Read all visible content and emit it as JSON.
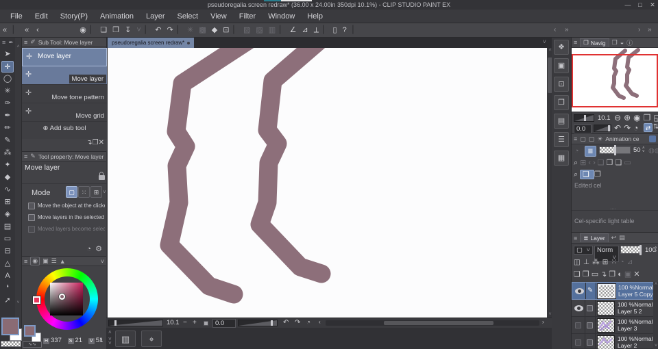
{
  "window": {
    "title": "pseudoregalia screen redraw* (36.00 x 24.00in 350dpi 10.1%)  - CLIP STUDIO PAINT EX",
    "minimize": "—",
    "maximize": "□",
    "close": "✕"
  },
  "menu": {
    "items": [
      {
        "name": "menu-file",
        "label": "File"
      },
      {
        "name": "menu-edit",
        "label": "Edit"
      },
      {
        "name": "menu-story",
        "label": "Story(P)"
      },
      {
        "name": "menu-animation",
        "label": "Animation"
      },
      {
        "name": "menu-layer",
        "label": "Layer"
      },
      {
        "name": "menu-select",
        "label": "Select"
      },
      {
        "name": "menu-view",
        "label": "View"
      },
      {
        "name": "menu-filter",
        "label": "Filter"
      },
      {
        "name": "menu-window",
        "label": "Window"
      },
      {
        "name": "menu-help",
        "label": "Help"
      }
    ]
  },
  "toolbar": {
    "icons": [
      {
        "name": "csp-logo-icon",
        "glyph": "◉"
      },
      {
        "name": "toolbar-sep-1",
        "glyph": "▏",
        "cls": "sep",
        "inter": false
      },
      {
        "name": "new-file-icon",
        "glyph": "❏"
      },
      {
        "name": "open-file-icon",
        "glyph": "❐"
      },
      {
        "name": "save-file-icon",
        "glyph": "↧"
      },
      {
        "name": "save-dropdown-caret",
        "glyph": "˅",
        "cls": "dim"
      },
      {
        "name": "toolbar-sep-2",
        "glyph": "▏",
        "cls": "sep",
        "inter": false
      },
      {
        "name": "undo-icon",
        "glyph": "↶"
      },
      {
        "name": "redo-icon",
        "glyph": "↷"
      },
      {
        "name": "toolbar-sep-3",
        "glyph": "▏",
        "cls": "sep",
        "inter": false
      },
      {
        "name": "clear-icon",
        "glyph": "✳",
        "cls": "dim"
      },
      {
        "name": "fill-area-icon",
        "glyph": "▩",
        "cls": "dim"
      },
      {
        "name": "bucket-fill-icon",
        "glyph": "◆"
      },
      {
        "name": "crop-canvas-icon",
        "glyph": "⊡"
      },
      {
        "name": "toolbar-sep-4",
        "glyph": "▏",
        "cls": "sep",
        "inter": false
      },
      {
        "name": "deselect-icon",
        "glyph": "▧",
        "cls": "dim"
      },
      {
        "name": "invert-selection-icon",
        "glyph": "▨",
        "cls": "dim"
      },
      {
        "name": "selection-border-icon",
        "glyph": "▥",
        "cls": "dim"
      },
      {
        "name": "toolbar-sep-5",
        "glyph": "▏",
        "cls": "sep",
        "inter": false
      },
      {
        "name": "snap-ruler-icon",
        "glyph": "∠"
      },
      {
        "name": "snap-special-ruler-icon",
        "glyph": "⊿"
      },
      {
        "name": "snap-grid-icon",
        "glyph": "⟂"
      },
      {
        "name": "toolbar-sep-6",
        "glyph": "▏",
        "cls": "sep",
        "inter": false
      },
      {
        "name": "tablet-mode-icon",
        "glyph": "▯"
      },
      {
        "name": "help-icon",
        "glyph": "?"
      }
    ]
  },
  "tools": [
    {
      "name": "operation-tool",
      "glyph": "➤"
    },
    {
      "name": "move-layer-tool",
      "glyph": "✛",
      "cls": "sel"
    },
    {
      "name": "selection-tool",
      "glyph": "◯"
    },
    {
      "name": "auto-select-tool",
      "glyph": "✳"
    },
    {
      "name": "eyedropper-tool",
      "glyph": "✑"
    },
    {
      "name": "pen-tool",
      "glyph": "✒"
    },
    {
      "name": "pencil-tool",
      "glyph": "✏"
    },
    {
      "name": "brush-tool",
      "glyph": "✎"
    },
    {
      "name": "airbrush-tool",
      "glyph": "⁂"
    },
    {
      "name": "decoration-tool",
      "glyph": "✦"
    },
    {
      "name": "eraser-tool",
      "glyph": "◆"
    },
    {
      "name": "blend-tool",
      "glyph": "∿"
    },
    {
      "name": "liquify-tool",
      "glyph": "⊞"
    },
    {
      "name": "fill-tool",
      "glyph": "◈"
    },
    {
      "name": "gradient-tool",
      "glyph": "▤"
    },
    {
      "name": "figure-tool",
      "glyph": "▭"
    },
    {
      "name": "frame-border-tool",
      "glyph": "⊟"
    },
    {
      "name": "ruler-tool",
      "glyph": "△"
    },
    {
      "name": "text-tool",
      "glyph": "A"
    },
    {
      "name": "balloon-tool",
      "glyph": "❛"
    },
    {
      "name": "correct-line-tool",
      "glyph": "➚"
    }
  ],
  "subtool": {
    "header": "Sub Tool: Move layer",
    "items": [
      "Move layer",
      "Move layer",
      "Move tone pattern",
      "Move grid"
    ],
    "add_label": "Add sub tool",
    "footer_icons": [
      {
        "name": "import-subtool-icon",
        "glyph": "↴"
      },
      {
        "name": "duplicate-subtool-icon",
        "glyph": "❐"
      },
      {
        "name": "delete-subtool-icon",
        "glyph": "✕"
      }
    ]
  },
  "toolprop": {
    "header": "Tool property: Move layer",
    "tool_name": "Move layer",
    "mode_label": "Mode",
    "options": [
      "Move the object at the clicke",
      "Move layers in the selected a",
      "Moved layers become selecte"
    ]
  },
  "colorpanel": {
    "h_label": "H",
    "s_label": "S",
    "v_label": "V",
    "h": "337",
    "s": "21",
    "v": "51",
    "main_color": "#8a6b74",
    "sub_color": "#ffffff"
  },
  "canvas": {
    "tab": "pseudoregalia screen redraw*",
    "stroke_color": "#8d6f7a",
    "strokes": [
      "M 213 -16 L 109 52 L 100 122 L 114 144 L 101 172 L 104 226 L 90 288 L 148 348 L 184 360",
      "M 315 -16 L 241 48 L 233 120 L 248 140 L 235 168 L 233 226 L 222 258 L 281 320 L 312 330"
    ],
    "zoom": "10.1",
    "rotation": "0.0"
  },
  "dock_icons": [
    {
      "name": "dock-quick-access-icon",
      "glyph": "❖"
    },
    {
      "name": "dock-material-icon",
      "glyph": "▣"
    },
    {
      "name": "dock-material-2-icon",
      "glyph": "⊡"
    },
    {
      "name": "dock-sub-view-icon",
      "glyph": "❐"
    },
    {
      "name": "dock-item-bank-icon",
      "glyph": "▤"
    },
    {
      "name": "dock-history-icon",
      "glyph": "☰"
    },
    {
      "name": "dock-3d-material-icon",
      "glyph": "▦"
    }
  ],
  "navigator": {
    "tab_label": "Navig",
    "zoom": "10.1",
    "rotation": "0.0",
    "frame_color": "#e03232",
    "strokes": [
      "M78 4 L64 16 L62 30 L65 34 L62 41 L62 52 L60 58 L69 70 L76 73",
      "M97 3 L83 14 L81 28 L84 32 L81 39 L81 50 L79 55 L88 67 L95 70"
    ],
    "row1_icons": [
      {
        "name": "zoom-out-icon",
        "glyph": "⊖"
      },
      {
        "name": "zoom-in-icon",
        "glyph": "⊕"
      },
      {
        "name": "zoom-100-icon",
        "glyph": "◉"
      },
      {
        "name": "fit-to-window-icon",
        "glyph": "❐"
      },
      {
        "name": "fit-to-screen-icon",
        "glyph": "◱"
      }
    ],
    "row2_icons": [
      {
        "name": "rotate-left-icon",
        "glyph": "↶"
      },
      {
        "name": "rotate-right-icon",
        "glyph": "↷"
      },
      {
        "name": "reset-rotation-icon",
        "glyph": "◔"
      }
    ]
  },
  "animation": {
    "tab_label": "Animation ce",
    "opacity": "50",
    "edited_cel": "Edited cel",
    "light_table": "Cel-specific light table",
    "row2_icons": [
      {
        "name": "register-image-icon",
        "glyph": "⌕"
      },
      {
        "name": "lock-cel-icon",
        "glyph": "⊞",
        "cls": "dim"
      },
      {
        "name": "prev-cel-icon",
        "glyph": "‹",
        "cls": "dim"
      },
      {
        "name": "next-cel-icon",
        "glyph": "›",
        "cls": "dim"
      },
      {
        "name": "new-cel-icon",
        "glyph": "❏",
        "cls": "dim"
      },
      {
        "name": "open-light-table-icon",
        "glyph": "❐"
      },
      {
        "name": "copy-cel-icon",
        "glyph": "❏"
      },
      {
        "name": "paste-cel-icon",
        "glyph": "▭",
        "cls": "dim"
      }
    ],
    "row3_icons": [
      {
        "name": "search-cel-icon",
        "glyph": "⌕"
      },
      {
        "name": "edit-cel-icon",
        "glyph": "❏",
        "cls": "blue"
      },
      {
        "name": "cel-copy-icon",
        "glyph": "❐"
      }
    ]
  },
  "layers": {
    "tab": "Layer",
    "blend": "Norm",
    "opacity": "100",
    "row2_icons": [
      {
        "name": "clip-to-layer-icon",
        "glyph": "◫"
      },
      {
        "name": "reference-layer-icon",
        "glyph": "⊥"
      },
      {
        "name": "draft-layer-icon",
        "glyph": "⁂"
      },
      {
        "name": "lock-layer-icon",
        "glyph": "⊞"
      },
      {
        "name": "lock-alpha-icon",
        "glyph": "⁙"
      },
      {
        "name": "enable-mask-icon",
        "glyph": "◔",
        "cls": "dim"
      },
      {
        "name": "ruler-range-icon",
        "glyph": "⊿",
        "cls": "dim"
      }
    ],
    "row3_icons": [
      {
        "name": "new-layer-icon",
        "glyph": "❏"
      },
      {
        "name": "new-vector-layer-icon",
        "glyph": "❒"
      },
      {
        "name": "new-folder-icon",
        "glyph": "▭"
      },
      {
        "name": "transfer-down-icon",
        "glyph": "↴"
      },
      {
        "name": "merge-down-icon",
        "glyph": "❐"
      },
      {
        "name": "layer-mask-icon",
        "glyph": "◐"
      },
      {
        "name": "apply-mask-icon",
        "glyph": "▣",
        "cls": "dim"
      },
      {
        "name": "delete-layer-icon",
        "glyph": "✕"
      }
    ],
    "items": [
      {
        "info": "100 %Normal",
        "name": "Layer 5 Copy"
      },
      {
        "info": "100 %Normal",
        "name": "Layer 5 2"
      },
      {
        "info": "100 %Normal",
        "name": "Layer 3"
      },
      {
        "info": "100 %Normal",
        "name": "Layer 2"
      }
    ]
  },
  "statusbar": {
    "zoom": "10.1",
    "rotation": "0.0"
  },
  "colors": {
    "accent_selection": "#54709c",
    "subtool_selected": "#6e81a3",
    "stroke_mauve": "#8d6f7a",
    "nav_frame_red": "#e03232"
  }
}
